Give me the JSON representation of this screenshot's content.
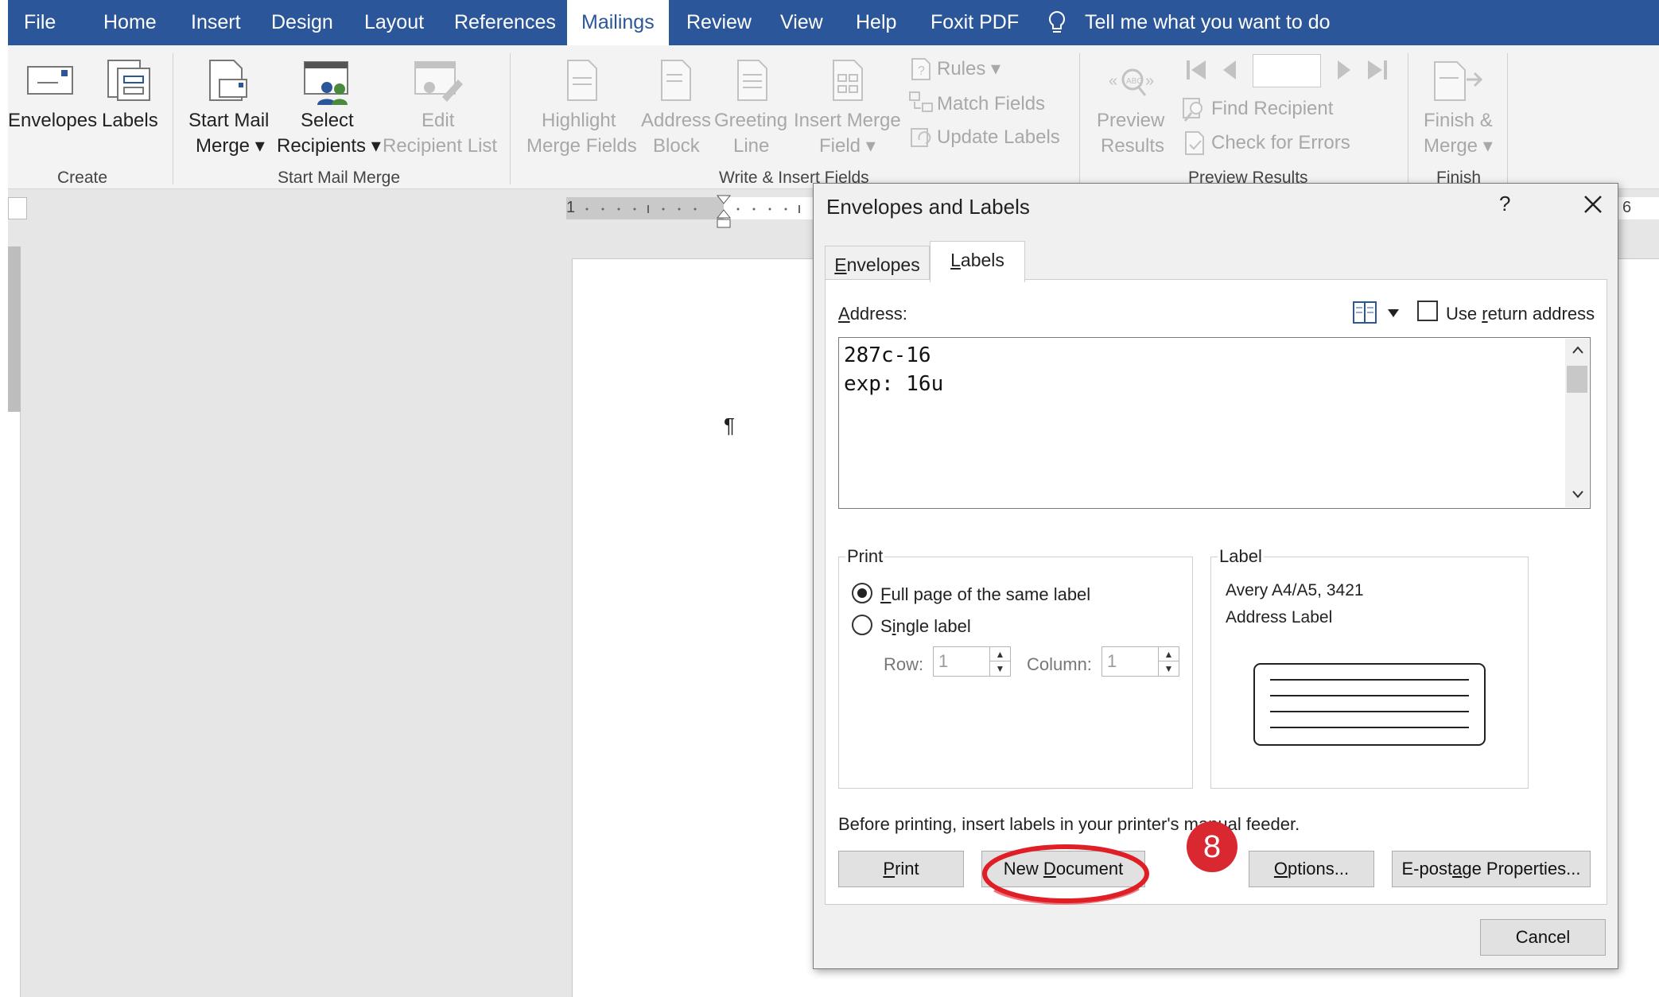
{
  "menu": {
    "items": [
      "File",
      "Home",
      "Insert",
      "Design",
      "Layout",
      "References",
      "Mailings",
      "Review",
      "View",
      "Help",
      "Foxit PDF"
    ],
    "tell_me": "Tell me what you want to do"
  },
  "ribbon": {
    "create": {
      "envelopes": "Envelopes",
      "labels": "Labels",
      "group": "Create"
    },
    "start": {
      "start_mail_1": "Start Mail",
      "start_mail_2": "Merge",
      "select_1": "Select",
      "select_2": "Recipients",
      "edit_1": "Edit",
      "edit_2": "Recipient List",
      "group": "Start Mail Merge"
    },
    "write": {
      "highlight_1": "Highlight",
      "highlight_2": "Merge Fields",
      "address_1": "Address",
      "address_2": "Block",
      "greeting_1": "Greeting",
      "greeting_2": "Line",
      "insert_1": "Insert Merge",
      "insert_2": "Field",
      "rules": "Rules",
      "match": "Match Fields",
      "update": "Update Labels",
      "group": "Write & Insert Fields"
    },
    "preview": {
      "preview_1": "Preview",
      "preview_2": "Results",
      "find": "Find Recipient",
      "check": "Check for Errors",
      "group": "Preview Results"
    },
    "finish": {
      "finish_1": "Finish &",
      "finish_2": "Merge",
      "group": "Finish"
    }
  },
  "ruler": {
    "left_num": "1",
    "right_num": "6"
  },
  "doc": {
    "pilcrow": "¶"
  },
  "dialog": {
    "title": "Envelopes and Labels",
    "help": "?",
    "tabs": {
      "envelopes_pre": "",
      "envelopes_u": "E",
      "envelopes_post": "nvelopes",
      "labels_pre": "",
      "labels_u": "L",
      "labels_post": "abels"
    },
    "address_label_u": "A",
    "address_label_post": "ddress:",
    "use_return_pre": "Use ",
    "use_return_u": "r",
    "use_return_post": "eturn address",
    "address_text": "287c-16\nexp: 16u",
    "print_group": "Print",
    "full_page_u": "F",
    "full_page_post": "ull page of the same label",
    "single_pre": "S",
    "single_u": "i",
    "single_post": "ngle label",
    "row_label": "Row:",
    "row_value": "1",
    "column_label": "Column:",
    "column_value": "1",
    "label_group": "Label",
    "label_line1": "Avery A4/A5, 3421",
    "label_line2": "Address Label",
    "note": "Before printing, insert labels in your printer's manual feeder.",
    "print_btn_u": "P",
    "print_btn_post": "rint",
    "newdoc_pre": "New ",
    "newdoc_u": "D",
    "newdoc_post": "ocument",
    "options_u": "O",
    "options_post": "ptions...",
    "epostage_pre": "E-post",
    "epostage_u": "a",
    "epostage_post": "ge Properties...",
    "cancel": "Cancel"
  },
  "annotation": {
    "step": "8",
    "color": "#d9282f"
  },
  "colors": {
    "accent": "#2b579a",
    "annotation": "#e01e26"
  }
}
